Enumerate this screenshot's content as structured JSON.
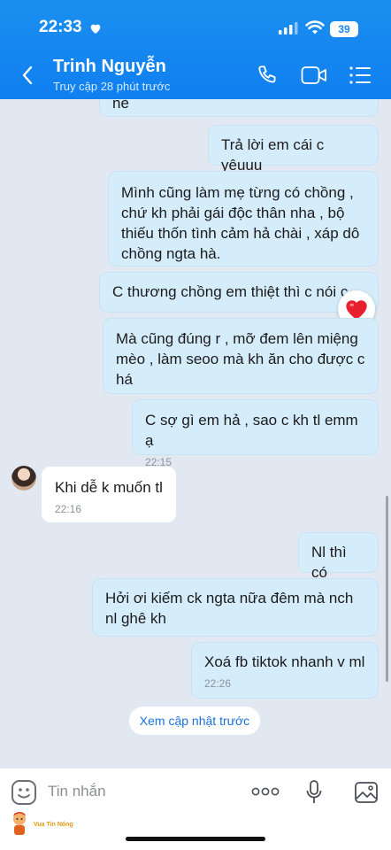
{
  "status_bar": {
    "time": "22:33",
    "battery": "39"
  },
  "header": {
    "name": "Trinh Nguyễn",
    "subtitle": "Truy cập 28 phút trước"
  },
  "messages": [
    {
      "dir": "out",
      "text": "nè"
    },
    {
      "dir": "out",
      "text": "Trả lời em cái c yêuuu"
    },
    {
      "dir": "out",
      "text": "Mình cũng làm mẹ từng có chồng , chứ kh phải gái độc thân nha , bộ thiếu thốn tình cảm hả chài , xáp dô chồng ngta hà."
    },
    {
      "dir": "out",
      "text": "C thương chồng em thiệt thì c nói c"
    },
    {
      "dir": "out",
      "text": "Mà cũng đúng r , mỡ đem lên miệng mèo , làm seoo mà kh ăn cho được c há"
    },
    {
      "dir": "out",
      "text": "C sợ gì em hả , sao c kh tl emm ạ",
      "time": "22:15"
    },
    {
      "dir": "in",
      "text": "Khi dễ k muốn tl",
      "time": "22:16"
    },
    {
      "dir": "out",
      "text": "Nl thì có"
    },
    {
      "dir": "out",
      "text": "Hởi ơi kiếm ck ngta nữa đêm mà nch nl ghê kh"
    },
    {
      "dir": "out",
      "text": "Xoá fb tiktok nhanh v ml",
      "time": "22:26"
    }
  ],
  "more_updates": "Xem cập nhật trước",
  "input": {
    "placeholder": "Tin nhắn"
  },
  "watermark": "Vua Tin Nóng",
  "colors": {
    "header": "#0f7ff0",
    "outgoing_bubble": "#d5ecfb",
    "incoming_bubble": "#ffffff",
    "background": "#e2e8f1"
  }
}
